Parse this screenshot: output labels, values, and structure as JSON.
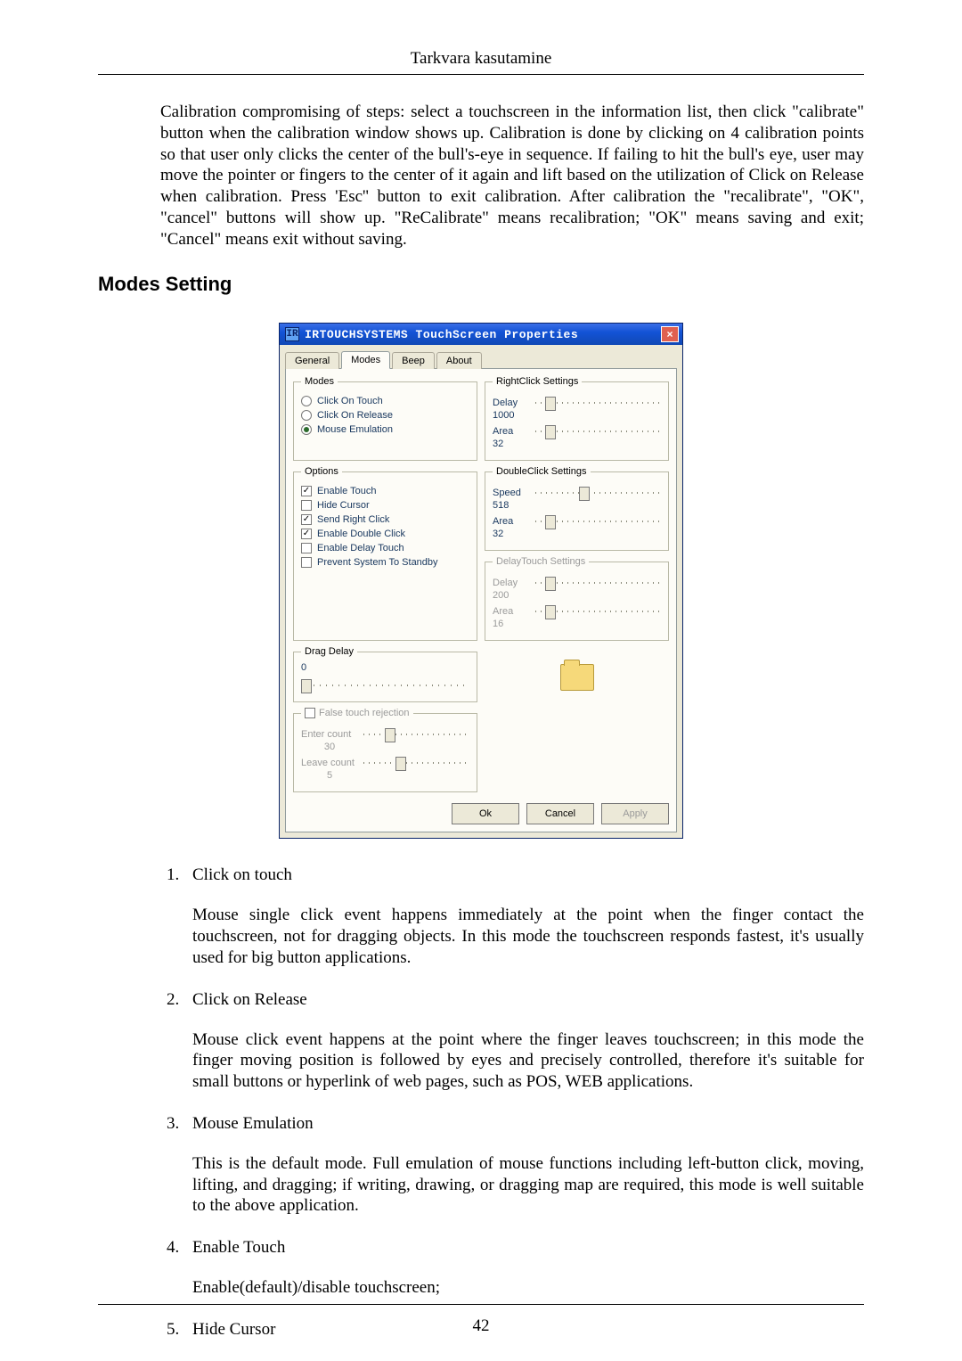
{
  "doc": {
    "header": "Tarkvara kasutamine",
    "page_number": "42",
    "section_heading": "Modes Setting",
    "intro_paragraph": "Calibration compromising of steps: select a touchscreen in the information list, then click \"calibrate\" button when the calibration window shows up. Calibration is done by clicking on 4 calibration points so that user only clicks the center of the bull's-eye in sequence. If failing to hit the bull's eye, user may move the pointer or fingers to the center of it again and lift based on the utilization of Click on Release when calibration. Press 'Esc'' button to exit calibration. After calibration the \"recalibrate\", \"OK\", \"cancel\" buttons will show up. \"ReCalibrate\" means recalibration; \"OK\" means saving and exit; \"Cancel\" means exit without saving."
  },
  "dialog": {
    "app_icon_text": "IR",
    "title": "IRTOUCHSYSTEMS TouchScreen Properties",
    "tabs": [
      "General",
      "Modes",
      "Beep",
      "About"
    ],
    "active_tab_index": 1,
    "groups": {
      "modes": {
        "legend": "Modes",
        "items": [
          {
            "label": "Click On Touch",
            "selected": false
          },
          {
            "label": "Click On Release",
            "selected": false
          },
          {
            "label": "Mouse Emulation",
            "selected": true
          }
        ]
      },
      "options": {
        "legend": "Options",
        "items": [
          {
            "label": "Enable Touch",
            "checked": true
          },
          {
            "label": "Hide Cursor",
            "checked": false
          },
          {
            "label": "Send Right Click",
            "checked": true
          },
          {
            "label": "Enable Double Click",
            "checked": true
          },
          {
            "label": "Enable Delay Touch",
            "checked": false
          },
          {
            "label": "Prevent System To Standby",
            "checked": false
          }
        ]
      },
      "drag_delay": {
        "legend": "Drag Delay",
        "value": "0"
      },
      "false_touch": {
        "legend": "False touch rejection",
        "checked": false,
        "enter_label": "Enter count",
        "enter_value": "30",
        "leave_label": "Leave count",
        "leave_value": "5"
      },
      "rightclick": {
        "legend": "RightClick Settings",
        "delay_label": "Delay",
        "delay_value": "1000",
        "area_label": "Area",
        "area_value": "32"
      },
      "doubleclick": {
        "legend": "DoubleClick Settings",
        "speed_label": "Speed",
        "speed_value": "518",
        "area_label": "Area",
        "area_value": "32"
      },
      "delaytouch": {
        "legend": "DelayTouch Settings",
        "disabled": true,
        "delay_label": "Delay",
        "delay_value": "200",
        "area_label": "Area",
        "area_value": "16"
      }
    },
    "buttons": {
      "ok": "Ok",
      "cancel": "Cancel",
      "apply": "Apply"
    }
  },
  "items": [
    {
      "title": "Click on touch",
      "body": "Mouse single click event happens immediately at the point when the finger contact the touchscreen, not for dragging objects. In this mode the touchscreen responds fastest, it's usually used for big button applications."
    },
    {
      "title": "Click on Release",
      "body": "Mouse click event happens at the point where the finger leaves touchscreen; in this mode the finger moving position is followed by eyes and precisely controlled, therefore it's suitable for small buttons or hyperlink of web pages, such as POS, WEB applications."
    },
    {
      "title": "Mouse Emulation",
      "body": "This is the default mode. Full emulation of mouse functions including left-button click, moving, lifting, and dragging; if writing, drawing, or dragging map are required, this mode is well suitable to the above application."
    },
    {
      "title": "Enable Touch",
      "body": "Enable(default)/disable touchscreen;"
    },
    {
      "title": "Hide Cursor",
      "body": ""
    }
  ]
}
